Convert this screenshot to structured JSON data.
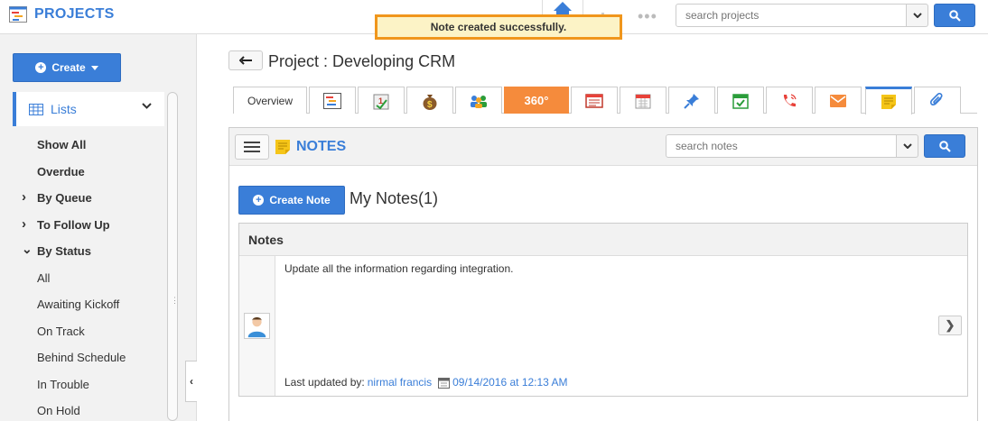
{
  "app": {
    "title": "PROJECTS",
    "brand_color": "#3a7ed8"
  },
  "topbar": {
    "search_placeholder": "search projects",
    "icons": [
      "home-icon",
      "chart-icon",
      "more-dots-icon",
      "chevron-down-icon",
      "search-icon"
    ]
  },
  "toast": {
    "message": "Note created successfully."
  },
  "sidebar": {
    "create_label": "Create",
    "lists_label": "Lists",
    "items": [
      {
        "label": "Show All",
        "bold": true,
        "arrow": ""
      },
      {
        "label": "Overdue",
        "bold": true,
        "arrow": ""
      },
      {
        "label": "By Queue",
        "bold": true,
        "arrow": "right"
      },
      {
        "label": "To Follow Up",
        "bold": true,
        "arrow": "right"
      },
      {
        "label": "By Status",
        "bold": true,
        "arrow": "down"
      },
      {
        "label": "All",
        "bold": false,
        "arrow": ""
      },
      {
        "label": "Awaiting Kickoff",
        "bold": false,
        "arrow": ""
      },
      {
        "label": "On Track",
        "bold": false,
        "arrow": ""
      },
      {
        "label": "Behind Schedule",
        "bold": false,
        "arrow": ""
      },
      {
        "label": "In Trouble",
        "bold": false,
        "arrow": ""
      },
      {
        "label": "On Hold",
        "bold": false,
        "arrow": ""
      }
    ]
  },
  "header": {
    "page_title": "Project : Developing CRM"
  },
  "tabs": {
    "overview_label": "Overview",
    "badge_360": "360°",
    "items": [
      "gantt-icon",
      "tasks-icon",
      "money-bag-icon",
      "team-icon",
      "360-icon",
      "invoice-icon",
      "calendar-icon",
      "pin-icon",
      "checkbox-calendar-icon",
      "phone-icon",
      "email-icon",
      "notes-icon",
      "attachment-icon"
    ],
    "active": "notes-icon"
  },
  "notes_panel": {
    "title": "NOTES",
    "search_placeholder": "search notes",
    "create_label": "Create Note",
    "heading": "My Notes(1)",
    "box_title": "Notes",
    "note": {
      "text": "Update all the information regarding integration.",
      "meta_label": "Last updated by:",
      "author": "nirmal francis",
      "timestamp": "09/14/2016 at 12:13 AM"
    }
  },
  "colors": {
    "accent": "#3a7ed8",
    "orange": "#f58b3c",
    "toast_bg": "#fcf3c6",
    "toast_border": "#f0961c"
  }
}
